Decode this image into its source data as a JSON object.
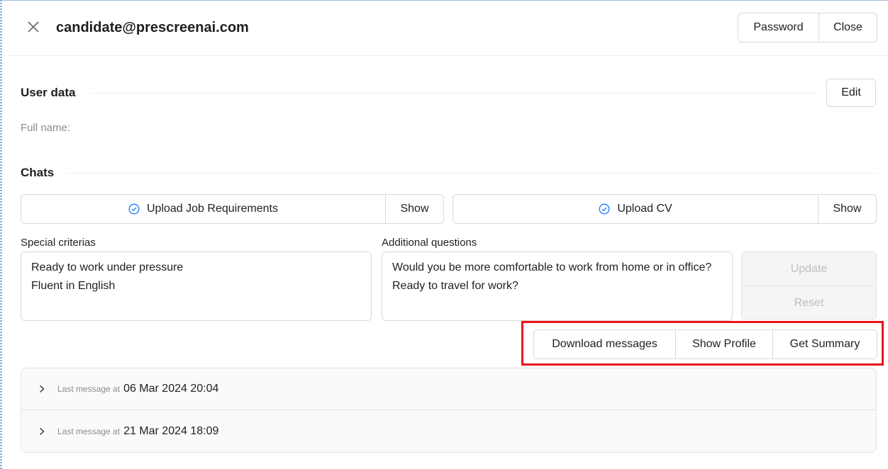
{
  "header": {
    "title": "candidate@prescreenai.com",
    "password_label": "Password",
    "close_label": "Close"
  },
  "user_data": {
    "title": "User data",
    "edit_label": "Edit",
    "full_name_label": "Full name",
    "full_name_colon": ":"
  },
  "chats": {
    "title": "Chats",
    "upload_job": "Upload Job Requirements",
    "upload_job_show": "Show",
    "upload_cv": "Upload CV",
    "upload_cv_show": "Show",
    "special_label": "Special criterias",
    "special_value": "Ready to work under pressure\nFluent in English",
    "additional_label": "Additional questions",
    "additional_value": "Would you be more comfortable to work from home or in office?\nReady to travel for work?",
    "update_label": "Update",
    "reset_label": "Reset",
    "download_label": "Download messages",
    "profile_label": "Show Profile",
    "summary_label": "Get Summary",
    "messages": [
      {
        "prefix": "Last message at",
        "date": "06 Mar 2024 20:04"
      },
      {
        "prefix": "Last message at",
        "date": "21 Mar 2024 18:09"
      }
    ]
  },
  "colors": {
    "accent": "#1677ff",
    "highlight": "#e8141c"
  }
}
